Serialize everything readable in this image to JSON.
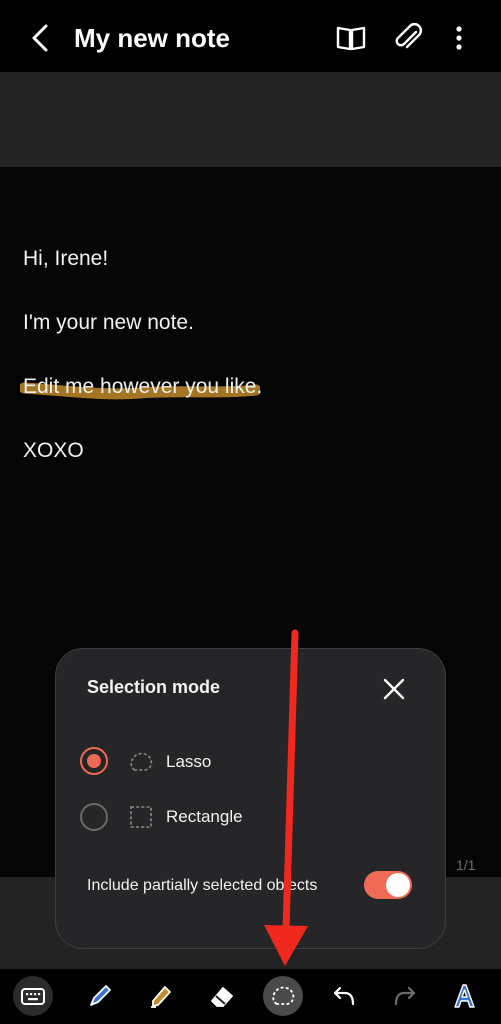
{
  "header": {
    "title": "My new note"
  },
  "note": {
    "lines": [
      "Hi, Irene!",
      "I'm your new note.",
      "Edit me however you like.",
      "XOXO"
    ],
    "page_indicator": "1/1"
  },
  "selection_popup": {
    "title": "Selection mode",
    "options": [
      {
        "label": "Lasso",
        "selected": true
      },
      {
        "label": "Rectangle",
        "selected": false
      }
    ],
    "partial_label": "Include partially selected objects",
    "partial_enabled": true
  },
  "toolbar": {
    "tools": [
      "keyboard-icon",
      "pen-icon",
      "highlighter-icon",
      "eraser-icon",
      "lasso-select-icon",
      "undo-icon",
      "redo-icon",
      "text-style-icon"
    ],
    "active_tool": "lasso-select-icon"
  },
  "colors": {
    "accent": "#ee6a55",
    "highlight": "#c28a2a",
    "arrow": "#f0281e"
  }
}
